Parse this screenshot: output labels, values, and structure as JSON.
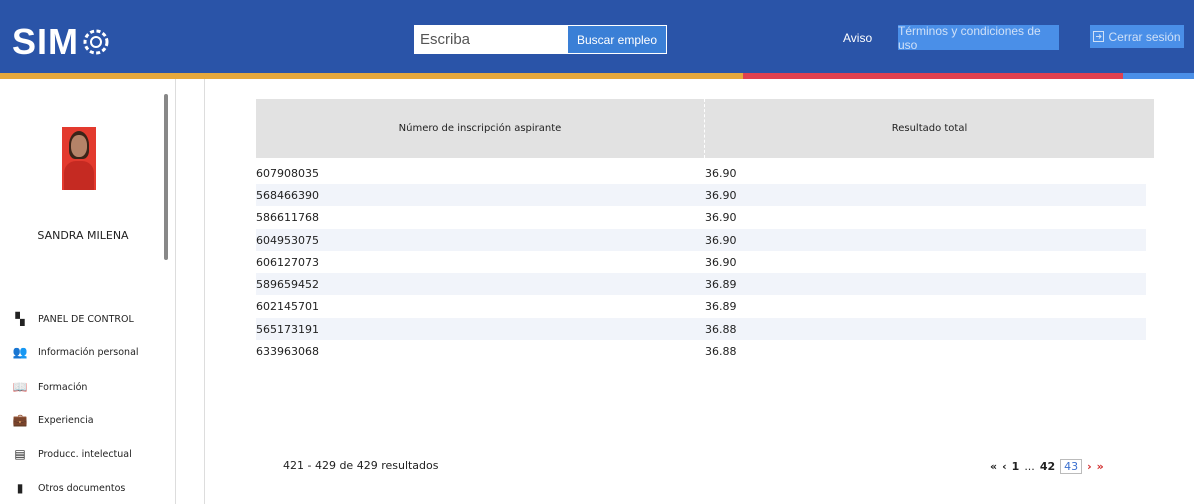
{
  "header": {
    "logo": "SIMO",
    "search_placeholder": "Escriba",
    "search_button": "Buscar empleo",
    "aviso": "Aviso",
    "terms": "Términos y condiciones de uso",
    "logout": "Cerrar sesión"
  },
  "sidebar": {
    "user_name": "SANDRA MILENA",
    "items": [
      {
        "label": "PANEL DE CONTROL",
        "icon": "dashboard-icon"
      },
      {
        "label": "Información personal",
        "icon": "people-icon"
      },
      {
        "label": "Formación",
        "icon": "education-icon"
      },
      {
        "label": "Experiencia",
        "icon": "briefcase-icon"
      },
      {
        "label": "Producc. intelectual",
        "icon": "publication-icon"
      },
      {
        "label": "Otros documentos",
        "icon": "document-icon"
      }
    ]
  },
  "table": {
    "columns": [
      "Número de inscripción aspirante",
      "Resultado total"
    ],
    "rows": [
      [
        "607908035",
        "36.90"
      ],
      [
        "568466390",
        "36.90"
      ],
      [
        "586611768",
        "36.90"
      ],
      [
        "604953075",
        "36.90"
      ],
      [
        "606127073",
        "36.90"
      ],
      [
        "589659452",
        "36.89"
      ],
      [
        "602145701",
        "36.89"
      ],
      [
        "565173191",
        "36.88"
      ],
      [
        "633963068",
        "36.88"
      ]
    ]
  },
  "footer": {
    "results": "421 - 429 de 429 resultados",
    "first": "«",
    "prev": "‹",
    "page_first": "1",
    "ellipsis": "...",
    "page_prev": "42",
    "page_current": "43",
    "next": "›",
    "last": "»"
  },
  "colors": {
    "header_bg": "#2a54a8",
    "accent_orange": "#e6a83c",
    "accent_red": "#e0414f",
    "accent_blue": "#4a8fe8"
  }
}
